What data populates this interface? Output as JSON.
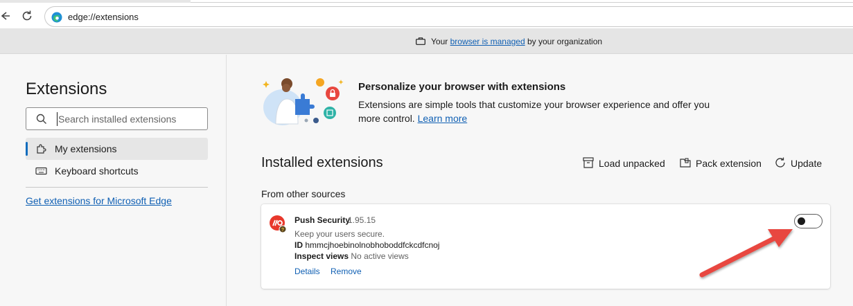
{
  "browser": {
    "address": "edge://extensions",
    "banner": {
      "prefix": "Your",
      "link": "browser is managed",
      "suffix": "by your organization"
    }
  },
  "sidebar": {
    "title": "Extensions",
    "search_placeholder": "Search installed extensions",
    "items": [
      {
        "label": "My extensions",
        "icon": "puzzle-gear-icon",
        "active": true
      },
      {
        "label": "Keyboard shortcuts",
        "icon": "keyboard-icon",
        "active": false
      }
    ],
    "get_extensions_link": "Get extensions for Microsoft Edge"
  },
  "main": {
    "promo": {
      "title": "Personalize your browser with extensions",
      "description": "Extensions are simple tools that customize your browser experience and offer you more control.",
      "learn_more": "Learn more"
    },
    "installed_title": "Installed extensions",
    "actions": {
      "load_unpacked": "Load unpacked",
      "pack_extension": "Pack extension",
      "update": "Update"
    },
    "section_label": "From other sources",
    "extension": {
      "name": "Push Security",
      "version": "1.95.15",
      "description": "Keep your users secure.",
      "id_label": "ID",
      "id_value": "hmmcjhoebinolnobhoboddfckcdfcnoj",
      "inspect_label": "Inspect views",
      "inspect_value": "No active views",
      "details_link": "Details",
      "remove_link": "Remove",
      "enabled": false
    }
  },
  "colors": {
    "accent": "#0f6cbd",
    "link": "#0f5fb3",
    "annotation_arrow": "#e8473f",
    "push_logo": "#e8382c"
  }
}
